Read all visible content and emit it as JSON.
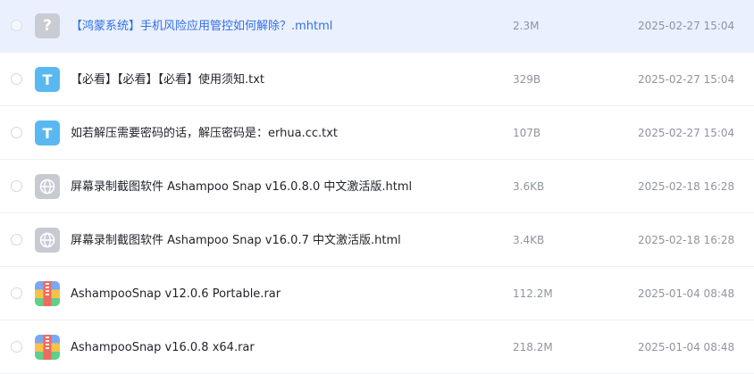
{
  "files": [
    {
      "name": "【鸿蒙系统】手机风险应用管控如何解除？.mhtml",
      "size": "2.3M",
      "date": "2025-02-27 15:04",
      "icon": "unknown-file-icon",
      "icon_glyph": "?",
      "selected": true
    },
    {
      "name": "【必看】【必看】【必看】使用须知.txt",
      "size": "329B",
      "date": "2025-02-27 15:04",
      "icon": "text-file-icon",
      "icon_glyph": "T",
      "selected": false
    },
    {
      "name": "如若解压需要密码的话，解压密码是：erhua.cc.txt",
      "size": "107B",
      "date": "2025-02-27 15:04",
      "icon": "text-file-icon",
      "icon_glyph": "T",
      "selected": false
    },
    {
      "name": "屏幕录制截图软件 Ashampoo Snap v16.0.8.0 中文激活版.html",
      "size": "3.6KB",
      "date": "2025-02-18 16:28",
      "icon": "html-file-icon",
      "icon_glyph": "",
      "selected": false
    },
    {
      "name": "屏幕录制截图软件 Ashampoo Snap v16.0.7 中文激活版.html",
      "size": "3.4KB",
      "date": "2025-02-18 16:28",
      "icon": "html-file-icon",
      "icon_glyph": "",
      "selected": false
    },
    {
      "name": "AshampooSnap v12.0.6 Portable.rar",
      "size": "112.2M",
      "date": "2025-01-04 08:48",
      "icon": "rar-archive-icon",
      "icon_glyph": "",
      "selected": false
    },
    {
      "name": "AshampooSnap v16.0.8 x64.rar",
      "size": "218.2M",
      "date": "2025-01-04 08:48",
      "icon": "rar-archive-icon",
      "icon_glyph": "",
      "selected": false
    }
  ],
  "colors": {
    "selected_row_bg": "#eaf0fd",
    "selected_text": "#3370e8",
    "text_icon": "#5ab8f0",
    "unknown_icon": "#c9ccd3",
    "meta_text": "#8f959e"
  }
}
